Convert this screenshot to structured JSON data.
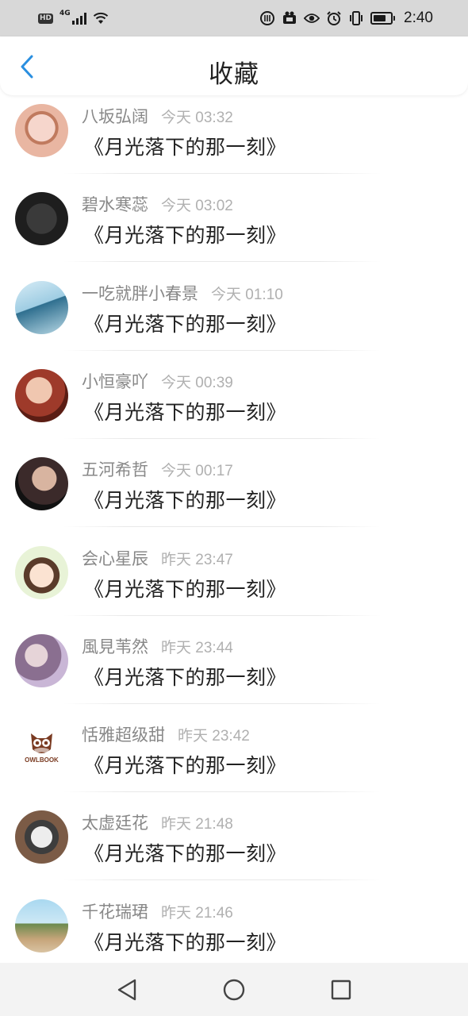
{
  "status_bar": {
    "hd": "HD",
    "network": "4G",
    "time": "2:40",
    "battery_level": 0.75,
    "icons": [
      "hd-icon",
      "signal-icon",
      "wifi-icon",
      "data-saver-icon",
      "vpn-icon",
      "eye-comfort-icon",
      "alarm-icon",
      "vibrate-icon",
      "battery-icon"
    ]
  },
  "header": {
    "title": "收藏",
    "back_icon": "chevron-left-icon",
    "accent_color": "#2a8fe0"
  },
  "favorites": [
    {
      "username": "八坂弘阔",
      "time": "今天 03:32",
      "title": "《月光落下的那一刻》",
      "avatar_icon": "avatar-image"
    },
    {
      "username": "碧水寒蕊",
      "time": "今天 03:02",
      "title": "《月光落下的那一刻》",
      "avatar_icon": "avatar-image"
    },
    {
      "username": "一吃就胖小春景",
      "time": "今天 01:10",
      "title": "《月光落下的那一刻》",
      "avatar_icon": "avatar-image"
    },
    {
      "username": "小恒豪吖",
      "time": "今天 00:39",
      "title": "《月光落下的那一刻》",
      "avatar_icon": "avatar-image"
    },
    {
      "username": "五河希哲",
      "time": "今天 00:17",
      "title": "《月光落下的那一刻》",
      "avatar_icon": "avatar-image"
    },
    {
      "username": "会心星辰",
      "time": "昨天 23:47",
      "title": "《月光落下的那一刻》",
      "avatar_icon": "avatar-image"
    },
    {
      "username": "風見苇然",
      "time": "昨天 23:44",
      "title": "《月光落下的那一刻》",
      "avatar_icon": "avatar-image"
    },
    {
      "username": "恬雅超级甜",
      "time": "昨天 23:42",
      "title": "《月光落下的那一刻》",
      "avatar_icon": "owl-logo-icon"
    },
    {
      "username": "太虚廷花",
      "time": "昨天 21:48",
      "title": "《月光落下的那一刻》",
      "avatar_icon": "avatar-image"
    },
    {
      "username": "千花瑞珺",
      "time": "昨天 21:46",
      "title": "《月光落下的那一刻》",
      "avatar_icon": "avatar-image"
    }
  ],
  "nav_bar": {
    "icons": [
      "back-triangle-icon",
      "home-circle-icon",
      "recents-square-icon"
    ]
  }
}
